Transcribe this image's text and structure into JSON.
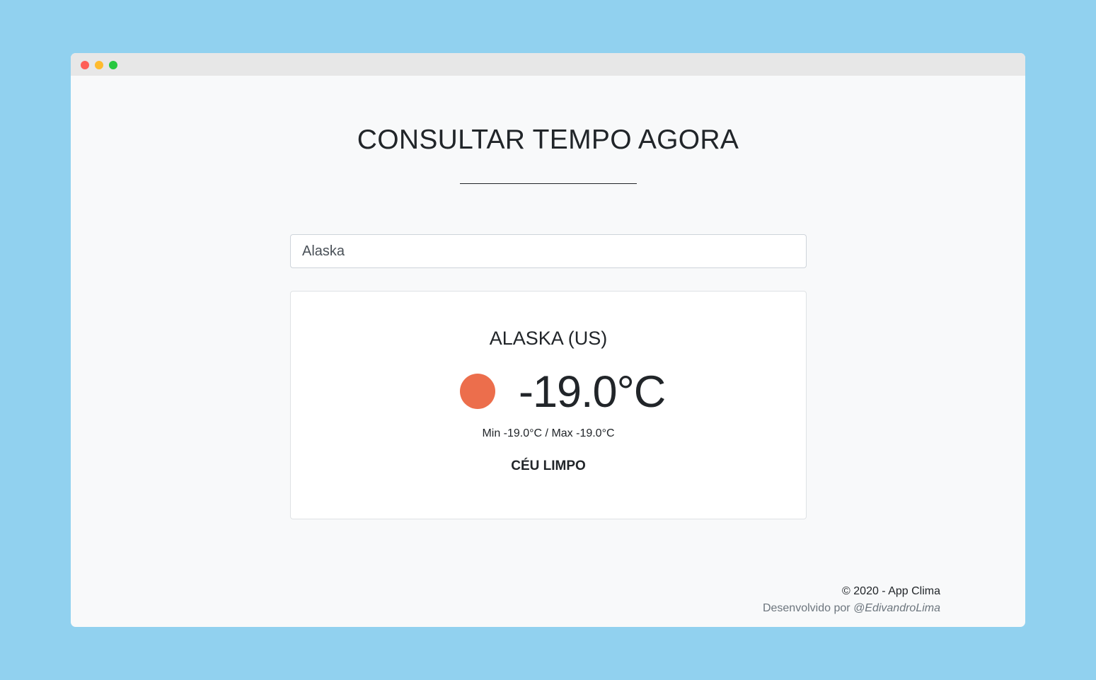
{
  "window": {
    "controls": [
      "close",
      "minimize",
      "maximize"
    ]
  },
  "header": {
    "title": "CONSULTAR TEMPO AGORA"
  },
  "search": {
    "value": "Alaska"
  },
  "weather": {
    "city": "ALASKA (US)",
    "icon": "sun-icon",
    "icon_color": "#ec6e4c",
    "temperature": "-19.0°C",
    "min_max": "Min -19.0°C / Max -19.0°C",
    "description": "CÉU LIMPO"
  },
  "footer": {
    "copyright": "© 2020 - App Clima",
    "developed_by": "Desenvolvido por ",
    "author": "@EdivandroLima"
  },
  "colors": {
    "background": "#91d1ef",
    "window": "#f8f9fa",
    "titlebar": "#e7e7e7"
  }
}
